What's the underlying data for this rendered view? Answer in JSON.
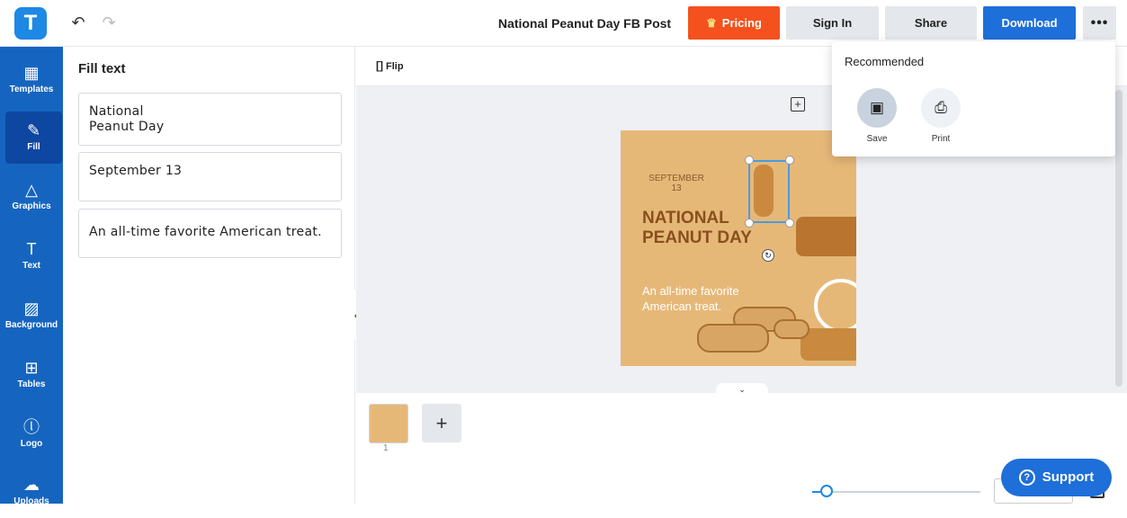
{
  "header": {
    "logo_letter": "T",
    "undo_glyph": "↶",
    "redo_glyph": "↷",
    "doc_title": "National Peanut Day FB Post",
    "pricing_label": "Pricing",
    "signin_label": "Sign In",
    "share_label": "Share",
    "download_label": "Download",
    "more_label": "•••"
  },
  "sidebar": {
    "items": [
      {
        "icon": "templates-icon",
        "glyph": "▦",
        "label": "Templates"
      },
      {
        "icon": "pencil-icon",
        "glyph": "✎",
        "label": "Fill"
      },
      {
        "icon": "shapes-icon",
        "glyph": "△",
        "label": "Graphics"
      },
      {
        "icon": "text-icon",
        "glyph": "T",
        "label": "Text"
      },
      {
        "icon": "background-icon",
        "glyph": "▨",
        "label": "Background"
      },
      {
        "icon": "table-icon",
        "glyph": "⊞",
        "label": "Tables"
      },
      {
        "icon": "logo-icon",
        "glyph": "ⓛ",
        "label": "Logo"
      },
      {
        "icon": "upload-cloud-icon",
        "glyph": "☁",
        "label": "Uploads"
      }
    ],
    "active": "Fill"
  },
  "fill_panel": {
    "title": "Fill text",
    "fields": [
      {
        "value": "National\nPeanut Day"
      },
      {
        "value": "September 13"
      },
      {
        "value": "An all-time favorite American treat."
      }
    ]
  },
  "canvas": {
    "flip_label": "Flip",
    "poster": {
      "date": "SEPTEMBER\n13",
      "title": "NATIONAL\nPEANUT DAY",
      "subtitle": "An all-time favorite\nAmerican treat."
    },
    "colors": {
      "poster_bg": "#e6b878",
      "title": "#8a4f1d",
      "accent": "#1e6fd9",
      "pricing": "#f4511e"
    }
  },
  "pages": {
    "current_number": "1",
    "add_label": "+"
  },
  "dropdown": {
    "title": "Recommended",
    "options": [
      {
        "icon": "save-icon",
        "glyph": "🖫",
        "label": "Save"
      },
      {
        "icon": "printer-icon",
        "glyph": "⎙",
        "label": "Print"
      }
    ]
  },
  "support": {
    "label": "Support"
  }
}
